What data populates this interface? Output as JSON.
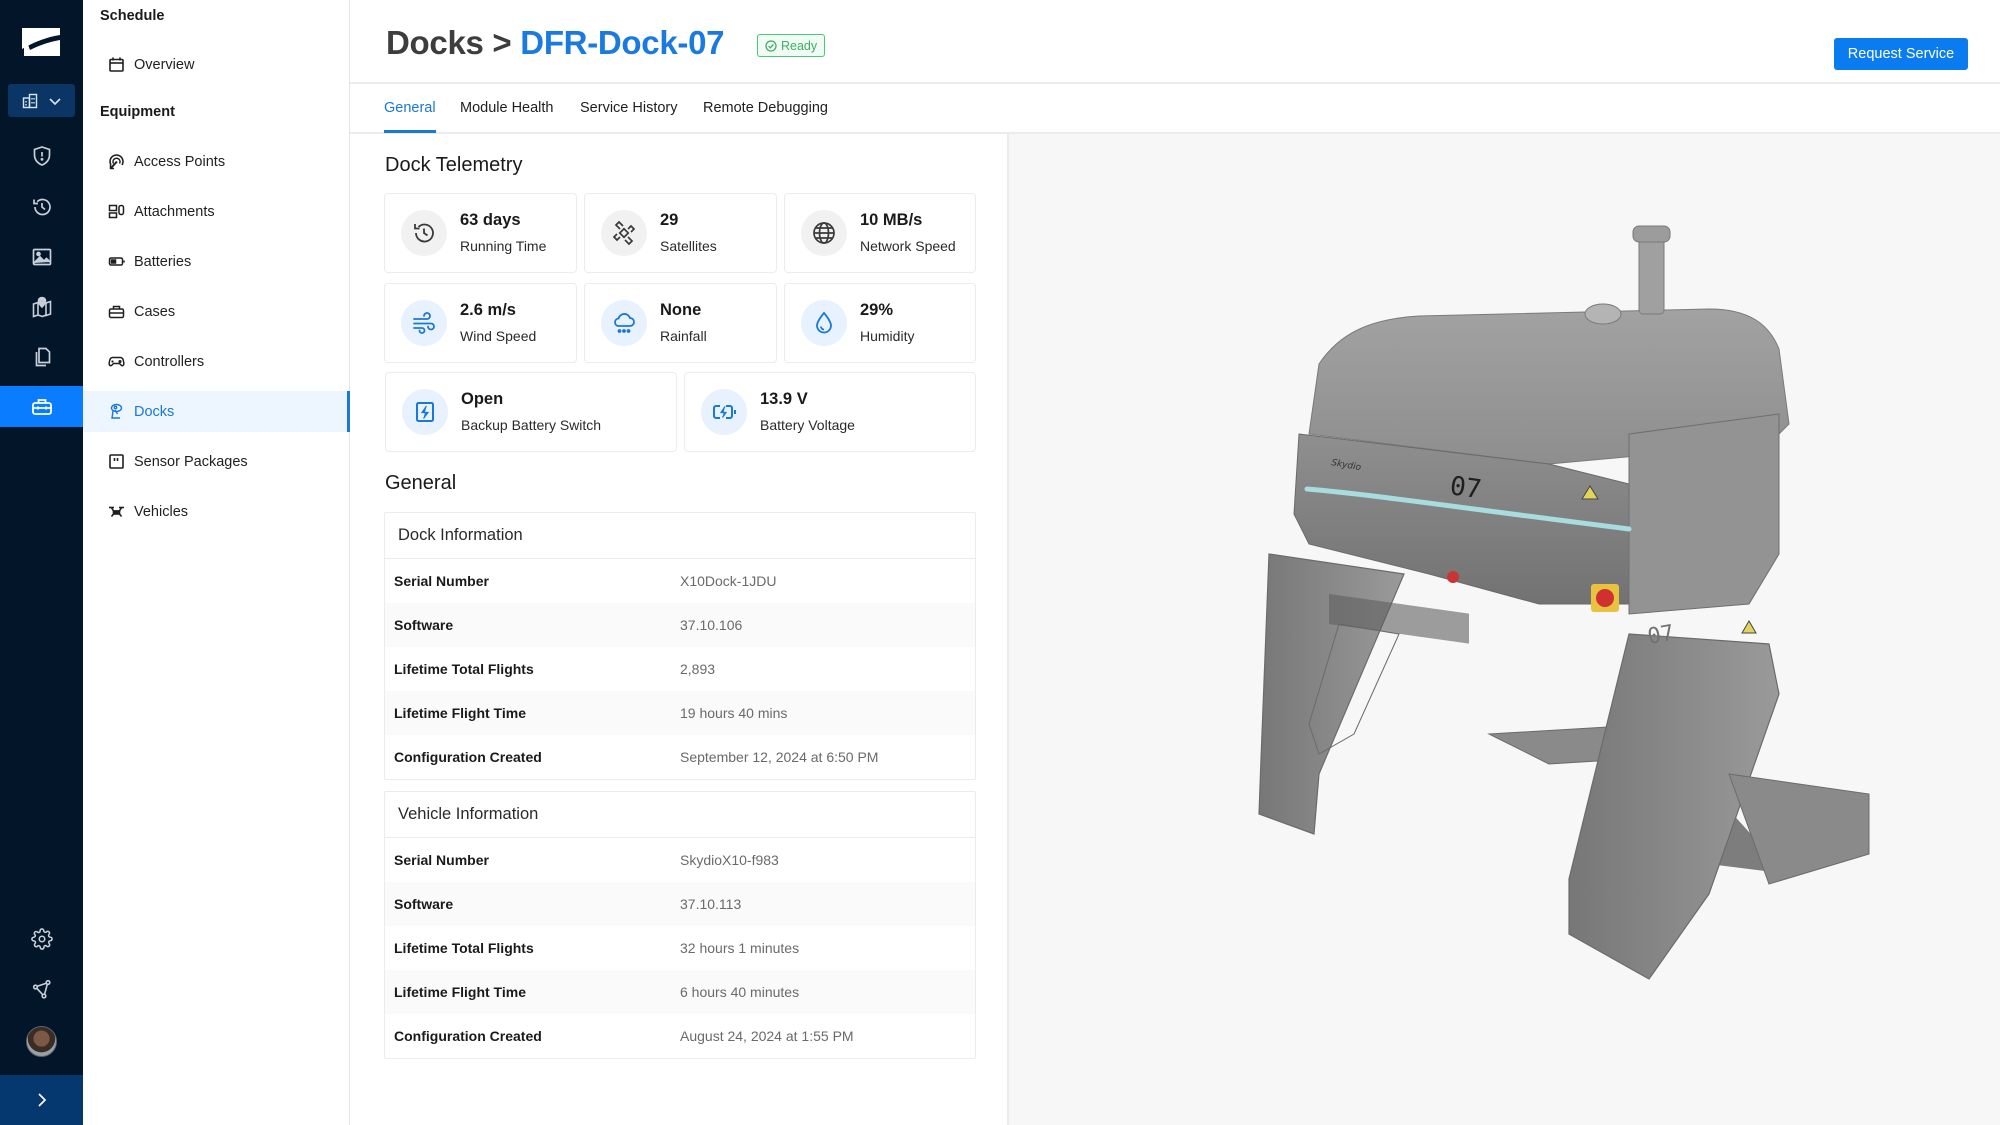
{
  "rail": {
    "items": [
      {
        "name": "alerts",
        "icon": "shield-alert-icon"
      },
      {
        "name": "history",
        "icon": "history-icon"
      },
      {
        "name": "media",
        "icon": "image-icon"
      },
      {
        "name": "maps",
        "icon": "map-pin-icon"
      },
      {
        "name": "documents",
        "icon": "copy-icon"
      },
      {
        "name": "equipment",
        "icon": "toolbox-icon",
        "active": true
      }
    ],
    "bottom": [
      {
        "name": "settings",
        "icon": "gear-icon"
      },
      {
        "name": "network",
        "icon": "share-nodes-icon"
      }
    ],
    "org_selector_icon": "buildings-icon",
    "expand_icon": "chevron-right-icon"
  },
  "sidebar": {
    "groups": [
      {
        "title": "Schedule",
        "items": [
          {
            "label": "Overview",
            "icon": "calendar-icon"
          }
        ]
      },
      {
        "title": "Equipment",
        "items": [
          {
            "label": "Access Points",
            "icon": "access-point-icon"
          },
          {
            "label": "Attachments",
            "icon": "attachments-icon"
          },
          {
            "label": "Batteries",
            "icon": "battery-icon"
          },
          {
            "label": "Cases",
            "icon": "case-icon"
          },
          {
            "label": "Controllers",
            "icon": "gamepad-icon"
          },
          {
            "label": "Docks",
            "icon": "dock-icon",
            "active": true
          },
          {
            "label": "Sensor Packages",
            "icon": "sensor-package-icon"
          },
          {
            "label": "Vehicles",
            "icon": "drone-icon"
          }
        ]
      }
    ]
  },
  "header": {
    "breadcrumb_parent": "Docks",
    "breadcrumb_separator": " > ",
    "title": "DFR-Dock-07",
    "status": "Ready",
    "status_color": "#3fae67",
    "request_button": "Request Service",
    "accent_color": "#1a78d6"
  },
  "tabs": [
    {
      "label": "General",
      "active": true
    },
    {
      "label": "Module Health"
    },
    {
      "label": "Service History"
    },
    {
      "label": "Remote Debugging"
    }
  ],
  "telemetry": {
    "title": "Dock Telemetry",
    "tiles": [
      {
        "value": "63 days",
        "label": "Running Time",
        "icon": "history-icon",
        "tone": "gray"
      },
      {
        "value": "29",
        "label": "Satellites",
        "icon": "satellite-icon",
        "tone": "gray"
      },
      {
        "value": "10 MB/s",
        "label": "Network Speed",
        "icon": "globe-icon",
        "tone": "gray"
      },
      {
        "value": "2.6 m/s",
        "label": "Wind Speed",
        "icon": "wind-icon",
        "tone": "blue"
      },
      {
        "value": "None",
        "label": "Rainfall",
        "icon": "rain-cloud-icon",
        "tone": "blue"
      },
      {
        "value": "29%",
        "label": "Humidity",
        "icon": "droplet-icon",
        "tone": "blue"
      },
      {
        "value": "Open",
        "label": "Backup Battery Switch",
        "icon": "power-switch-icon",
        "tone": "blue"
      },
      {
        "value": "13.9 V",
        "label": "Battery Voltage",
        "icon": "battery-charging-icon",
        "tone": "blue"
      }
    ]
  },
  "general": {
    "title": "General",
    "dock_info": {
      "title": "Dock Information",
      "rows": [
        {
          "key": "Serial Number",
          "value": "X10Dock-1JDU"
        },
        {
          "key": "Software",
          "value": "37.10.106"
        },
        {
          "key": "Lifetime Total Flights",
          "value": "2,893"
        },
        {
          "key": "Lifetime Flight Time",
          "value": "19 hours 40 mins"
        },
        {
          "key": "Configuration Created",
          "value": "September 12, 2024 at 6:50 PM"
        }
      ]
    },
    "vehicle_info": {
      "title": "Vehicle Information",
      "rows": [
        {
          "key": "Serial Number",
          "value": "SkydioX10-f983"
        },
        {
          "key": "Software",
          "value": "37.10.113"
        },
        {
          "key": "Lifetime Total Flights",
          "value": "32 hours 1 minutes"
        },
        {
          "key": "Lifetime Flight Time",
          "value": "6 hours 40 minutes"
        },
        {
          "key": "Configuration Created",
          "value": "August 24, 2024 at 1:55 PM"
        }
      ]
    }
  },
  "model": {
    "brand_text": "Skydio",
    "unit_number": "07"
  }
}
